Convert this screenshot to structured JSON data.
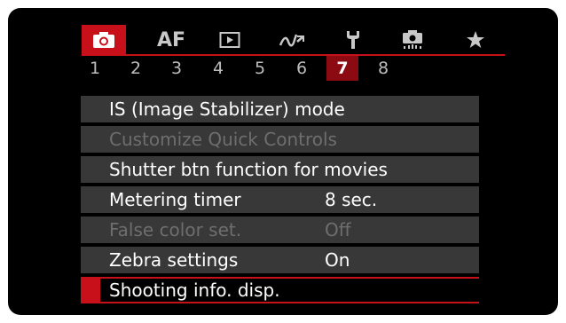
{
  "tabs": [
    {
      "name": "shooting-tab",
      "icon": "camera-icon",
      "text": ""
    },
    {
      "name": "af-tab",
      "icon": "",
      "text": "AF"
    },
    {
      "name": "playback-tab",
      "icon": "play-icon",
      "text": ""
    },
    {
      "name": "wireless-tab",
      "icon": "wireless-icon",
      "text": ""
    },
    {
      "name": "setup-tab",
      "icon": "wrench-icon",
      "text": ""
    },
    {
      "name": "custom-function-tab",
      "icon": "custom-camera-icon",
      "text": ""
    },
    {
      "name": "my-menu-tab",
      "icon": "star-icon",
      "text": ""
    }
  ],
  "page_numbers": [
    "1",
    "2",
    "3",
    "4",
    "5",
    "6",
    "7",
    "8"
  ],
  "active_page": "7",
  "menu_items": [
    {
      "label": "IS (Image Stabilizer) mode",
      "value": "",
      "state": "enabled"
    },
    {
      "label": "Customize Quick Controls",
      "value": "",
      "state": "disabled"
    },
    {
      "label": "Shutter btn function for movies",
      "value": "",
      "state": "enabled"
    },
    {
      "label": "Metering timer",
      "value": "8 sec.",
      "state": "enabled"
    },
    {
      "label": "False color set.",
      "value": "Off",
      "state": "disabled"
    },
    {
      "label": "Zebra settings",
      "value": "On",
      "state": "enabled"
    }
  ],
  "selected_item": {
    "label": "Shooting info. disp."
  },
  "colors": {
    "accent": "#c8101a",
    "row_bg": "#383838",
    "disabled_text": "#6e6e6e",
    "screen_bg": "#000000"
  }
}
